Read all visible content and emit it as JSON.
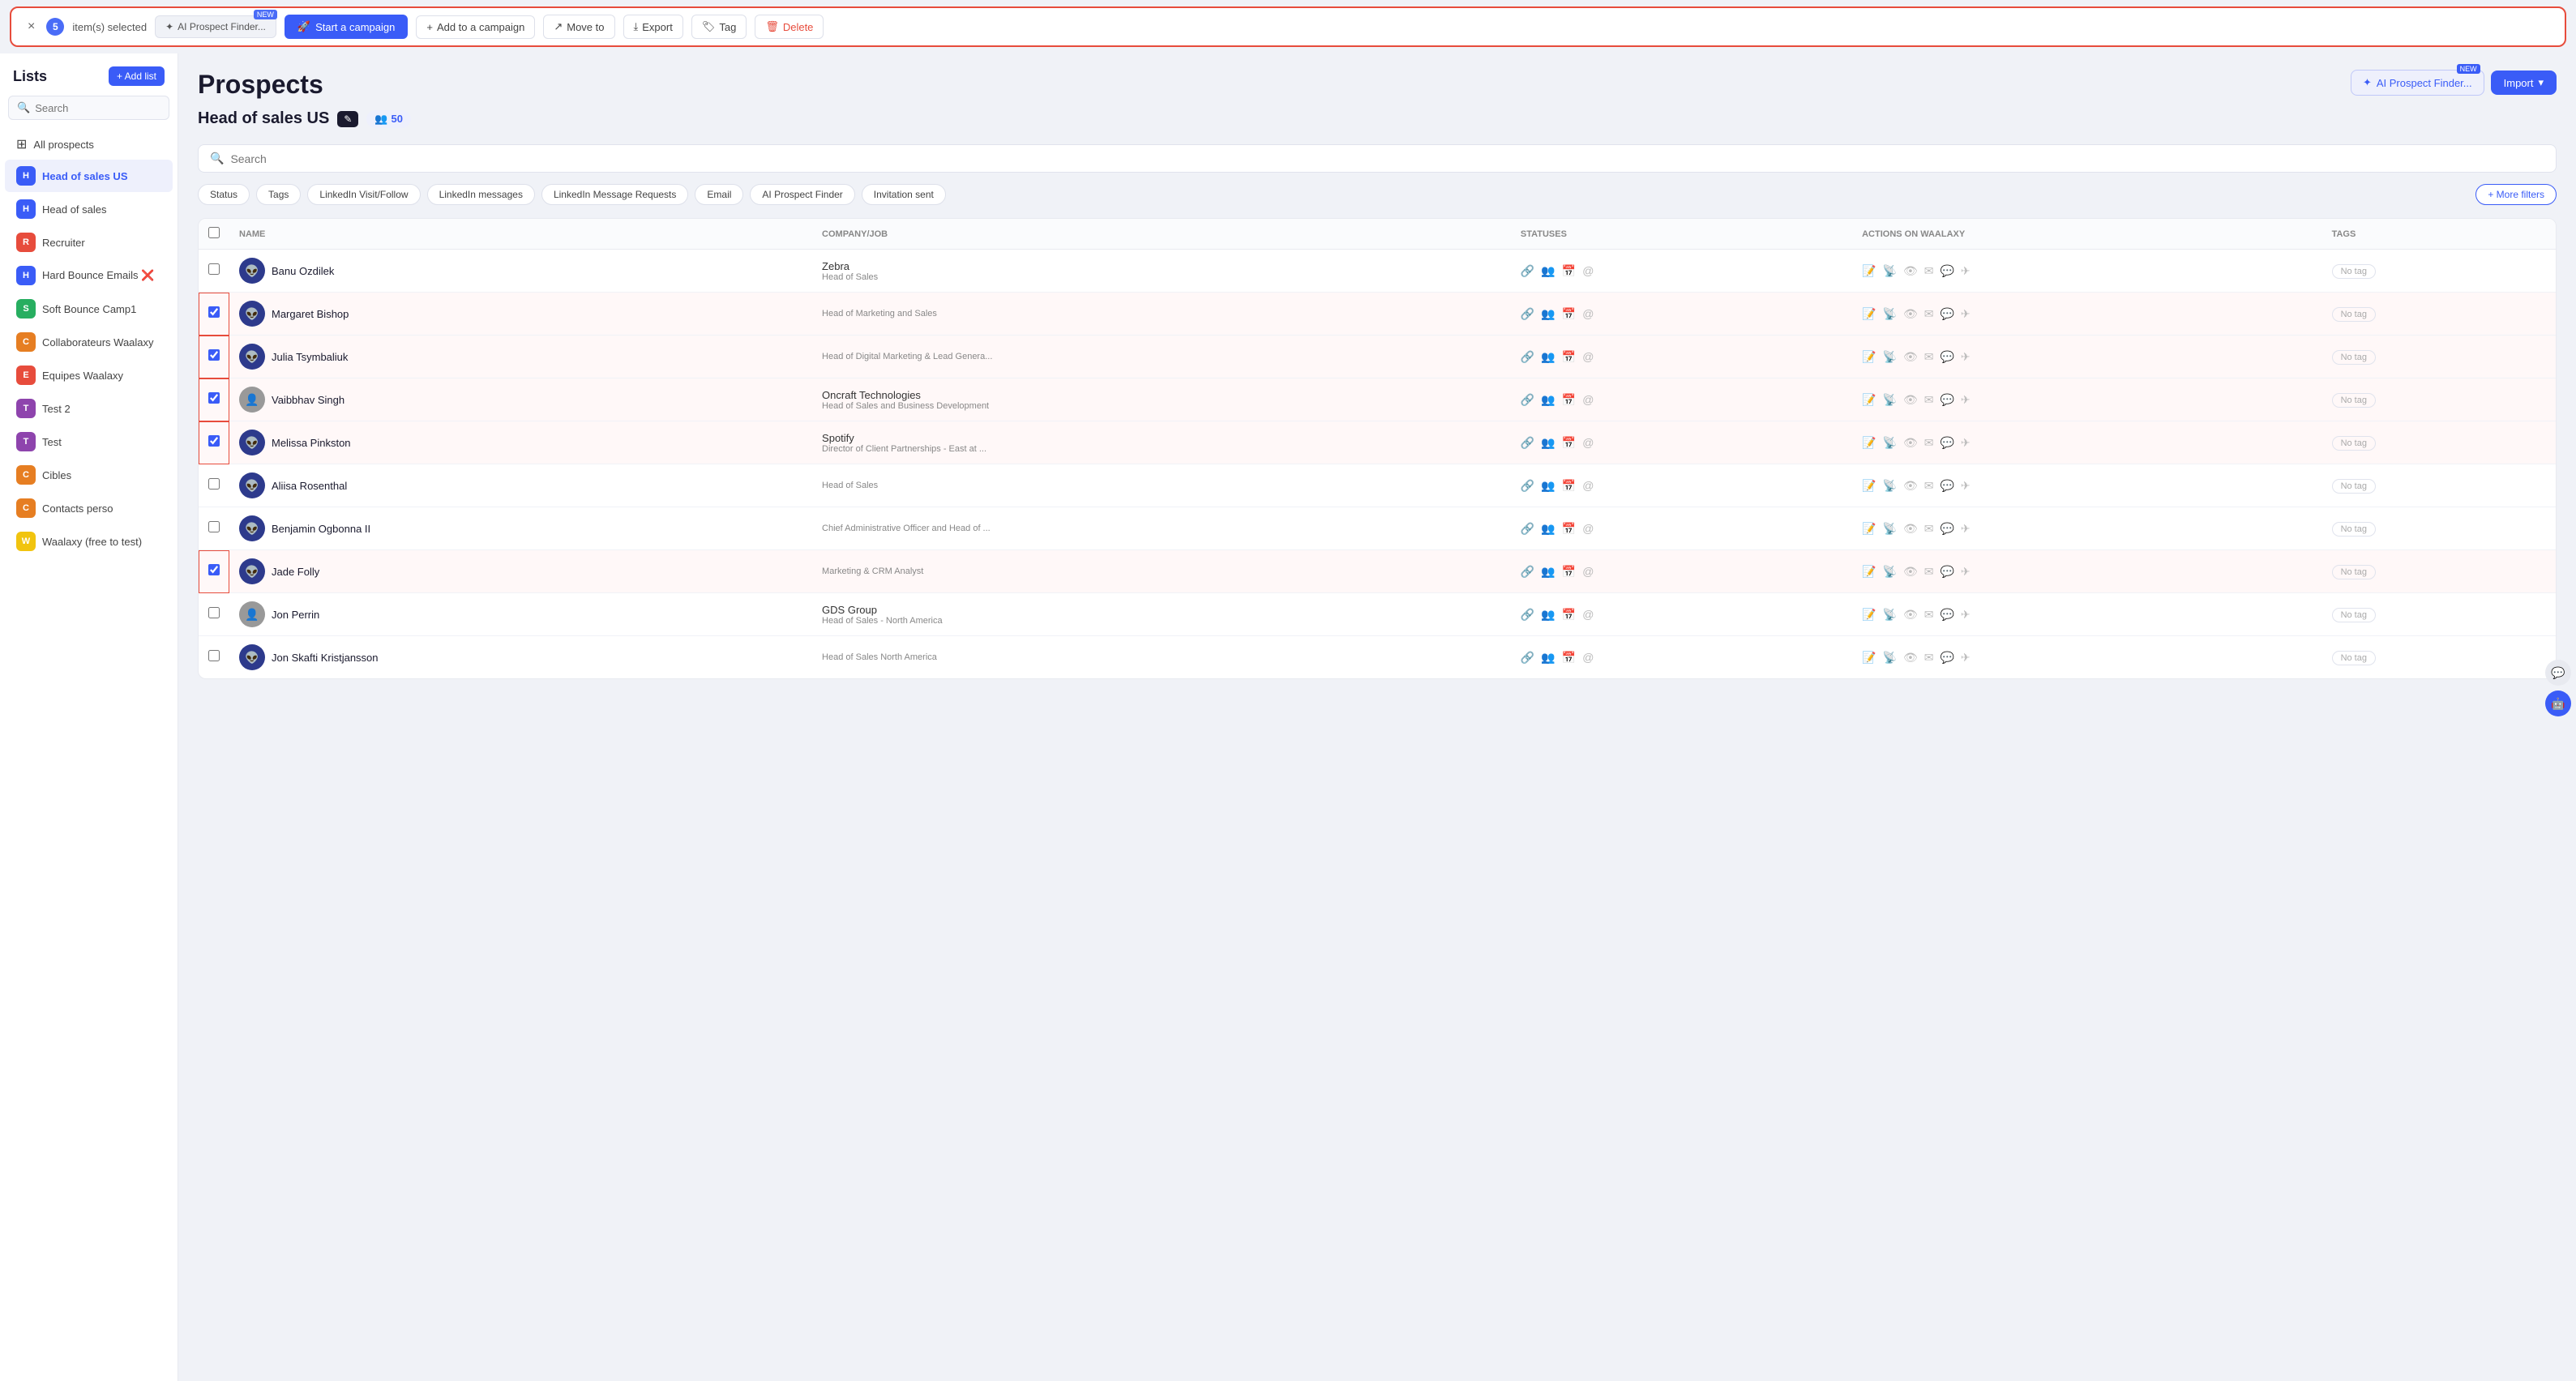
{
  "actionBar": {
    "closeLabel": "×",
    "selectedCount": "5",
    "selectedLabel": "item(s) selected",
    "aiProspectLabel": "AI Prospect Finder...",
    "newBadge": "NEW",
    "startCampaignLabel": "Start a campaign",
    "addToCampaignLabel": "Add to a campaign",
    "moveToLabel": "Move to",
    "exportLabel": "Export",
    "tagLabel": "Tag",
    "deleteLabel": "Delete"
  },
  "sidebar": {
    "title": "Lists",
    "addListLabel": "+ Add list",
    "searchPlaceholder": "Search",
    "allProspectsLabel": "All prospects",
    "items": [
      {
        "id": "head-of-sales-us",
        "label": "Head of sales US",
        "color": "#3a5cf7",
        "letter": "H",
        "active": true
      },
      {
        "id": "head-of-sales",
        "label": "Head of sales",
        "color": "#3a5cf7",
        "letter": "H"
      },
      {
        "id": "recruiter",
        "label": "Recruiter",
        "color": "#e74c3c",
        "letter": "R"
      },
      {
        "id": "hard-bounce",
        "label": "Hard Bounce Emails ❌",
        "color": "#3a5cf7",
        "letter": "H"
      },
      {
        "id": "soft-bounce",
        "label": "Soft Bounce Camp1",
        "color": "#27ae60",
        "letter": "S"
      },
      {
        "id": "collaborateurs",
        "label": "Collaborateurs Waalaxy",
        "color": "#e67e22",
        "letter": "C"
      },
      {
        "id": "equipes",
        "label": "Equipes Waalaxy",
        "color": "#e74c3c",
        "letter": "E"
      },
      {
        "id": "test2",
        "label": "Test 2",
        "color": "#8e44ad",
        "letter": "T"
      },
      {
        "id": "test",
        "label": "Test",
        "color": "#8e44ad",
        "letter": "T"
      },
      {
        "id": "cibles",
        "label": "Cibles",
        "color": "#e67e22",
        "letter": "C"
      },
      {
        "id": "contacts-perso",
        "label": "Contacts perso",
        "color": "#e67e22",
        "letter": "C"
      },
      {
        "id": "waalaxy-free",
        "label": "Waalaxy (free to test)",
        "color": "#f1c40f",
        "letter": "W"
      }
    ]
  },
  "content": {
    "pageTitle": "Prospects",
    "listName": "Head of sales US",
    "editLabel": "✎",
    "countIcon": "👥",
    "count": "50",
    "searchPlaceholder": "Search",
    "filters": {
      "statusLabel": "Status",
      "tagsLabel": "Tags",
      "linkedinVisitLabel": "LinkedIn Visit/Follow",
      "linkedinMessagesLabel": "LinkedIn messages",
      "linkedinMsgRequestsLabel": "LinkedIn Message Requests",
      "emailLabel": "Email",
      "aiProspectLabel": "AI Prospect Finder",
      "invitationSentLabel": "Invitation sent",
      "moreFiltersLabel": "+ More filters"
    },
    "aiProspectFinderLabel": "AI Prospect Finder...",
    "newBadgeLabel": "NEW",
    "importLabel": "Import",
    "importDropdown": "▾"
  },
  "table": {
    "headers": {
      "name": "NAME",
      "companyJob": "COMPANY/JOB",
      "statuses": "STATUSES",
      "actionsOnWaalaxy": "ACTIONS ON WAALAXY",
      "tags": "TAGS"
    },
    "rows": [
      {
        "id": 1,
        "name": "Banu Ozdilek",
        "company": "Zebra",
        "job": "Head of Sales",
        "checked": false,
        "tag": "No tag",
        "hasPhoto": false
      },
      {
        "id": 2,
        "name": "Margaret Bishop",
        "company": "",
        "job": "Head of Marketing and Sales",
        "checked": true,
        "tag": "No tag",
        "hasPhoto": false
      },
      {
        "id": 3,
        "name": "Julia Tsymbaliuk",
        "company": "",
        "job": "Head of Digital Marketing & Lead Genera...",
        "checked": true,
        "tag": "No tag",
        "hasPhoto": false
      },
      {
        "id": 4,
        "name": "Vaibbhav Singh",
        "company": "Oncraft Technologies",
        "job": "Head of Sales and Business Development",
        "checked": true,
        "tag": "No tag",
        "hasPhoto": true
      },
      {
        "id": 5,
        "name": "Melissa Pinkston",
        "company": "Spotify",
        "job": "Director of Client Partnerships - East at ...",
        "checked": true,
        "tag": "No tag",
        "hasPhoto": false
      },
      {
        "id": 6,
        "name": "Aliisa Rosenthal",
        "company": "",
        "job": "Head of Sales",
        "checked": false,
        "tag": "No tag",
        "hasPhoto": false
      },
      {
        "id": 7,
        "name": "Benjamin Ogbonna II",
        "company": "",
        "job": "Chief Administrative Officer and Head of ...",
        "checked": false,
        "tag": "No tag",
        "hasPhoto": false
      },
      {
        "id": 8,
        "name": "Jade Folly",
        "company": "",
        "job": "Marketing & CRM Analyst",
        "checked": true,
        "tag": "No tag",
        "hasPhoto": false
      },
      {
        "id": 9,
        "name": "Jon Perrin",
        "company": "GDS Group",
        "job": "Head of Sales - North America",
        "checked": false,
        "tag": "No tag",
        "hasPhoto": true
      },
      {
        "id": 10,
        "name": "Jon Skafti Kristjansson",
        "company": "",
        "job": "Head of Sales North America",
        "checked": false,
        "tag": "No tag",
        "hasPhoto": false
      }
    ]
  }
}
